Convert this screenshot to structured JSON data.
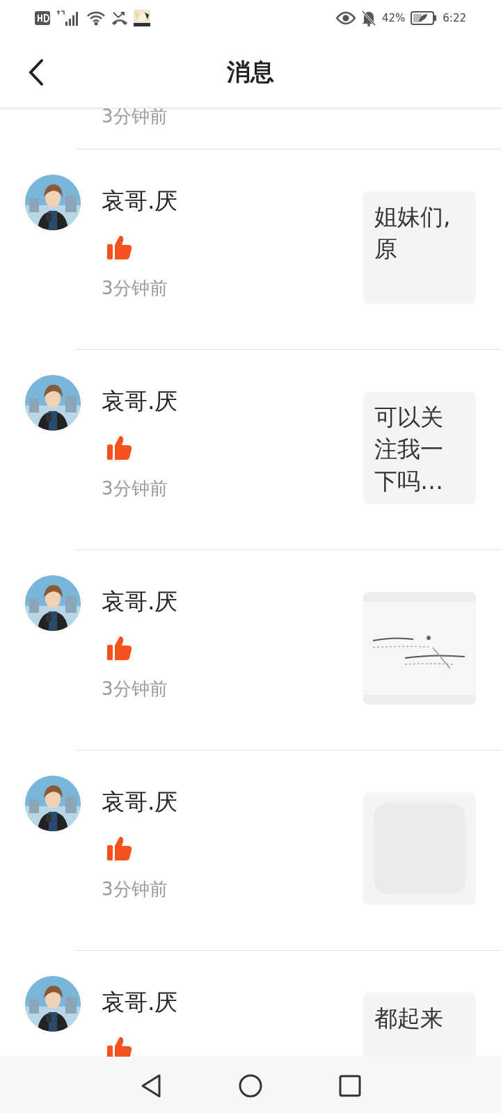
{
  "status_bar": {
    "battery": "42%",
    "time": "6:22"
  },
  "header": {
    "title": "消息"
  },
  "partial_item": {
    "time": "3分钟前"
  },
  "messages": [
    {
      "user": "哀哥.厌",
      "time": "3分钟前",
      "preview": {
        "kind": "text",
        "text": "姐妹们,原"
      }
    },
    {
      "user": "哀哥.厌",
      "time": "3分钟前",
      "preview": {
        "kind": "text",
        "text": "可以关注我一下吗…"
      }
    },
    {
      "user": "哀哥.厌",
      "time": "3分钟前"
    },
    {
      "user": "哀哥.厌",
      "time": "3分钟前",
      "preview": {
        "kind": "blank"
      }
    },
    {
      "user": "哀哥.厌",
      "preview": {
        "kind": "text",
        "text": "都起来"
      }
    }
  ]
}
